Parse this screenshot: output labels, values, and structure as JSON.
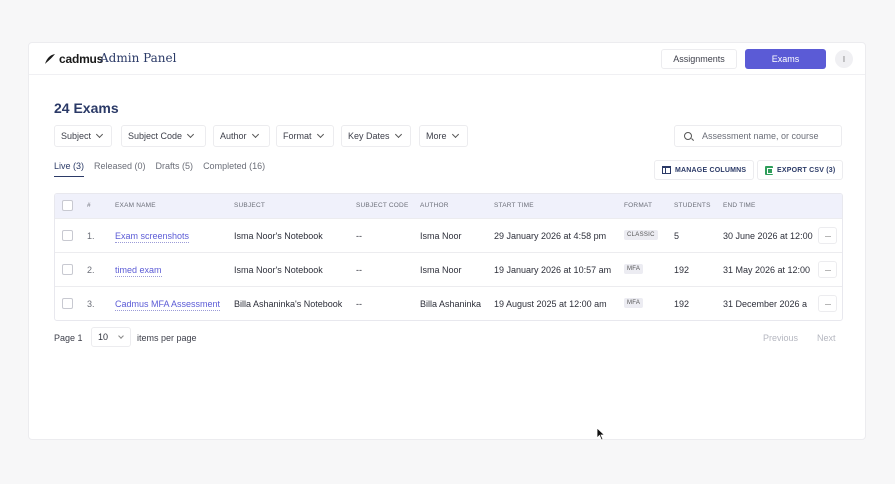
{
  "header": {
    "logo_text": "cadmus",
    "panel_title": "Admin Panel",
    "nav": {
      "assignments": "Assignments",
      "exams": "Exams"
    },
    "avatar": "I"
  },
  "page_title": "24 Exams",
  "filters": [
    {
      "label": "Subject"
    },
    {
      "label": "Subject Code"
    },
    {
      "label": "Author"
    },
    {
      "label": "Format"
    },
    {
      "label": "Key Dates"
    },
    {
      "label": "More"
    }
  ],
  "search": {
    "placeholder": "Assessment name, or course"
  },
  "tabs": [
    {
      "label": "Live (3)",
      "active": true
    },
    {
      "label": "Released (0)"
    },
    {
      "label": "Drafts (5)"
    },
    {
      "label": "Completed (16)"
    }
  ],
  "actions": {
    "manage_columns": "MANAGE COLUMNS",
    "export_csv": "EXPORT CSV (3)"
  },
  "table": {
    "headers": [
      "#",
      "EXAM NAME",
      "SUBJECT",
      "SUBJECT CODE",
      "AUTHOR",
      "START TIME",
      "FORMAT",
      "STUDENTS",
      "END TIME"
    ],
    "rows": [
      {
        "num": "1.",
        "name": "Exam screenshots",
        "subject": "Isma Noor's Notebook",
        "code": "--",
        "author": "Isma Noor",
        "start": "29 January 2026 at 4:58 pm",
        "format": "CLASSIC",
        "students": "5",
        "end": "30 June 2026 at 12:00"
      },
      {
        "num": "2.",
        "name": "timed exam",
        "subject": "Isma Noor's Notebook",
        "code": "--",
        "author": "Isma Noor",
        "start": "19 January 2026 at 10:57 am",
        "format": "MFA",
        "students": "192",
        "end": "31 May 2026 at 12:00"
      },
      {
        "num": "3.",
        "name": "Cadmus MFA Assessment",
        "subject": "Billa Ashaninka's Notebook",
        "code": "--",
        "author": "Billa Ashaninka",
        "start": "19 August 2025 at 12:00 am",
        "format": "MFA",
        "students": "192",
        "end": "31 December 2026 a"
      }
    ],
    "more_label": "···"
  },
  "pagination": {
    "page_label": "Page 1",
    "per_page_value": "10",
    "per_page_label": "items per page",
    "previous": "Previous",
    "next": "Next"
  },
  "colors": {
    "accent": "#5b5bd6",
    "title": "#2b3a67",
    "header_bg": "#f0f1fb"
  }
}
